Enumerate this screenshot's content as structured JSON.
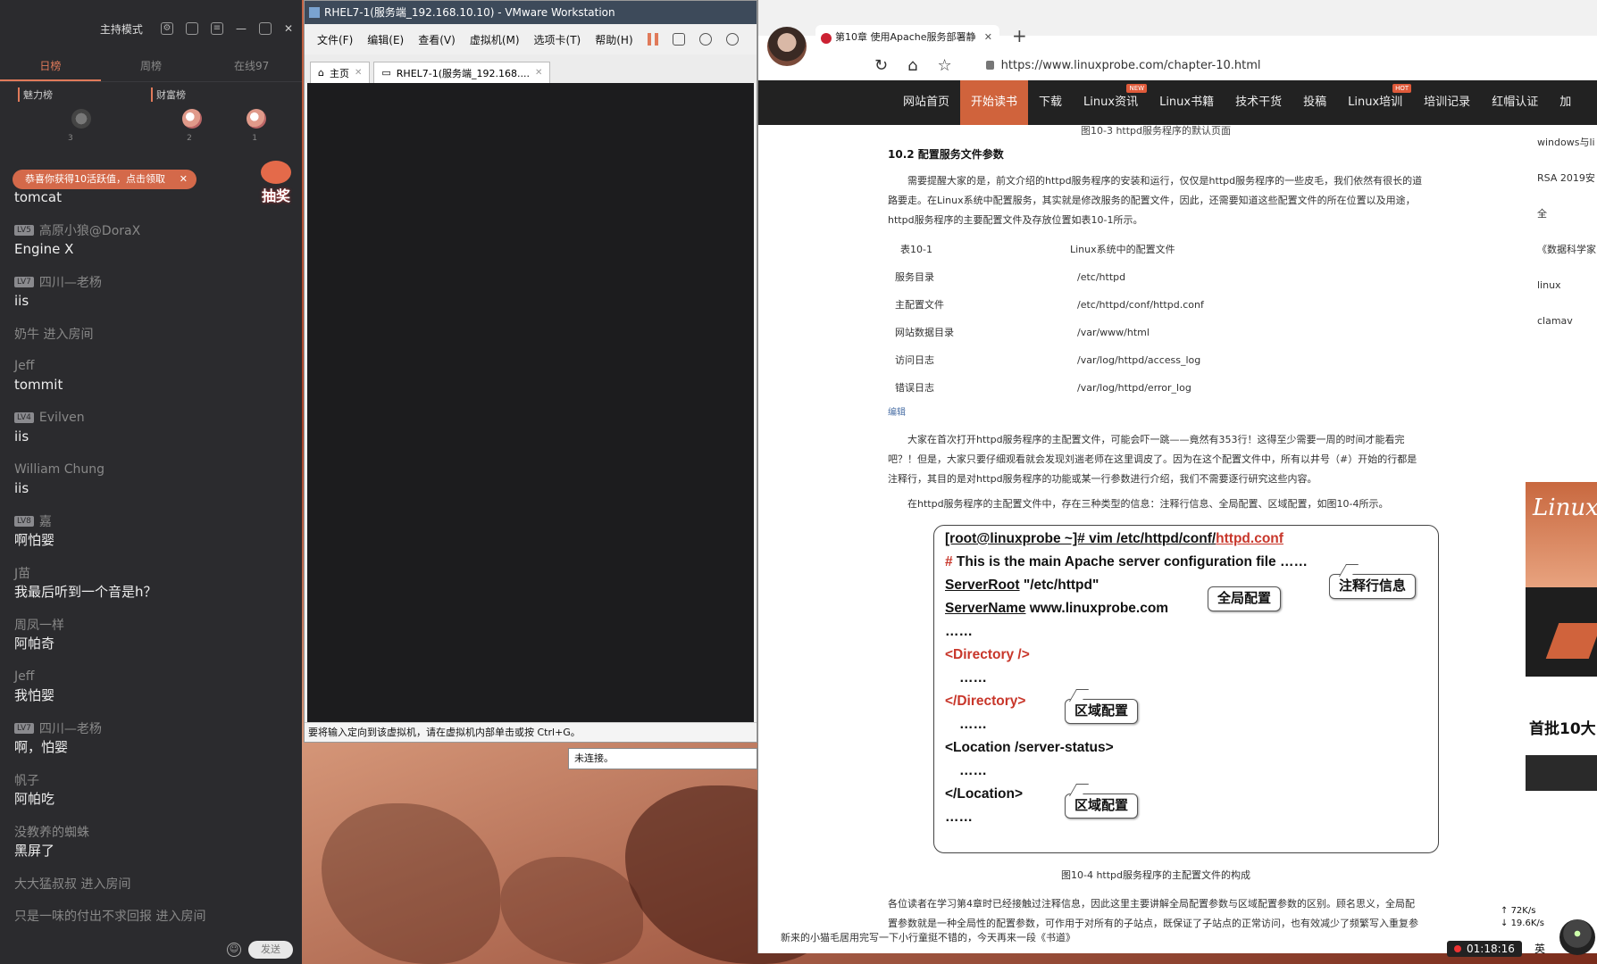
{
  "chat": {
    "mode_label": "主持模式",
    "tabs": [
      "日榜",
      "周榜",
      "在线97"
    ],
    "rank_labels": [
      "魅力榜",
      "财富榜"
    ],
    "rank_numbers": [
      "3",
      "2",
      "1"
    ],
    "gift_banner": "恭喜你获得10活跃值，点击领取",
    "lottery_label": "抽奖",
    "messages": [
      {
        "user": "",
        "lv": "",
        "text": "tomcat"
      },
      {
        "user": "高原小狼@DoraX",
        "lv": "LV5",
        "text": "Engine X"
      },
      {
        "user": "四川—老杨",
        "lv": "LV7",
        "text": "iis"
      },
      {
        "user": "奶牛 进入房间",
        "lv": "",
        "text": ""
      },
      {
        "user": "Jeff",
        "lv": "",
        "text": "tommit"
      },
      {
        "user": "Evilven",
        "lv": "LV4",
        "text": "iis"
      },
      {
        "user": "William Chung",
        "lv": "",
        "text": "iis"
      },
      {
        "user": "嘉",
        "lv": "LV8",
        "text": "啊怕婴"
      },
      {
        "user": "J苗",
        "lv": "",
        "text": "我最后听到一个音是h？"
      },
      {
        "user": "周凤一样",
        "lv": "",
        "text": "阿帕奇"
      },
      {
        "user": "Jeff",
        "lv": "",
        "text": "我怕婴"
      },
      {
        "user": "四川—老杨",
        "lv": "LV7",
        "text": "啊，怕婴"
      },
      {
        "user": "帆子",
        "lv": "",
        "text": "阿帕吃"
      },
      {
        "user": "没教养的蜘蛛",
        "lv": "",
        "text": "黑屏了"
      },
      {
        "user": "大大猛叔叔 进入房间",
        "lv": "",
        "text": ""
      },
      {
        "user": "只是一味的付出不求回报 进入房间",
        "lv": "",
        "text": ""
      }
    ],
    "send_label": "发送"
  },
  "vmware": {
    "title": "RHEL7-1(服务端_192.168.10.10) - VMware Workstation",
    "menu": [
      "文件(F)",
      "编辑(E)",
      "查看(V)",
      "虚拟机(M)",
      "选项卡(T)",
      "帮助(H)"
    ],
    "tabs": [
      "主页",
      "RHEL7-1(服务端_192.168...."
    ],
    "status": "要将输入定向到该虚拟机，请在虚拟机内部单击或按 Ctrl+G。",
    "not_connected": "未连接。"
  },
  "browser": {
    "tab_title": "第10章 使用Apache服务部署静",
    "url": "https://www.linuxprobe.com/chapter-10.html",
    "nav": [
      {
        "label": "网站首页",
        "badge": ""
      },
      {
        "label": "开始读书",
        "badge": "",
        "active": true
      },
      {
        "label": "下载",
        "badge": ""
      },
      {
        "label": "Linux资讯",
        "badge": "NEW"
      },
      {
        "label": "Linux书籍",
        "badge": ""
      },
      {
        "label": "技术干货",
        "badge": ""
      },
      {
        "label": "投稿",
        "badge": ""
      },
      {
        "label": "Linux培训",
        "badge": "HOT"
      },
      {
        "label": "培训记录",
        "badge": ""
      },
      {
        "label": "红帽认证",
        "badge": ""
      },
      {
        "label": "加",
        "badge": ""
      }
    ]
  },
  "article": {
    "fig_caption_top": "图10-3  httpd服务程序的默认页面",
    "section_title": "10.2 配置服务文件参数",
    "para1": "需要提醒大家的是，前文介绍的httpd服务程序的安装和运行，仅仅是httpd服务程序的一些皮毛，我们依然有很长的道路要走。在Linux系统中配置服务，其实就是修改服务的配置文件，因此，还需要知道这些配置文件的所在位置以及用途，httpd服务程序的主要配置文件及存放位置如表10-1所示。",
    "table_caption_left": "表10-1",
    "table_caption_right": "Linux系统中的配置文件",
    "table_rows": [
      [
        "服务目录",
        "/etc/httpd"
      ],
      [
        "主配置文件",
        "/etc/httpd/conf/httpd.conf"
      ],
      [
        "网站数据目录",
        "/var/www/html"
      ],
      [
        "访问日志",
        "/var/log/httpd/access_log"
      ],
      [
        "错误日志",
        "/var/log/httpd/error_log"
      ]
    ],
    "edit_label": "编辑",
    "para2": "大家在首次打开httpd服务程序的主配置文件，可能会吓一跳——竟然有353行！这得至少需要一周的时间才能看完吧？！但是，大家只要仔细观看就会发现刘遄老师在这里调皮了。因为在这个配置文件中，所有以井号（#）开始的行都是注释行，其目的是对httpd服务程序的功能或某一行参数进行介绍，我们不需要逐行研究这些内容。",
    "para3": "在httpd服务程序的主配置文件中，存在三种类型的信息：注释行信息、全局配置、区域配置，如图10-4所示。",
    "fig_caption": "图10-4  httpd服务程序的主配置文件的构成",
    "para4": "各位读者在学习第4章时已经接触过注释信息，因此这里主要讲解全局配置参数与区域配置参数的区别。顾名思义，全局配置参数就是一种全局性的配置参数，可作用于对所有的子站点，既保证了子站点的正常访问，也有效减少了频繁写入重复参数的工作量。区域"
  },
  "code": {
    "prompt": "[root@linuxprobe ~]# vim /etc/httpd/conf/",
    "prompt_file": "httpd.conf",
    "comment_hash": "#",
    "comment": " This is the main Apache server configuration file ……",
    "server_root_key": "ServerRoot",
    "server_root_val": "  \"/etc/httpd\"",
    "server_name_key": "ServerName",
    "server_name_val": "  www.linuxprobe.com",
    "dots1": "……",
    "dir_open": "<Directory  />",
    "dots2": "……",
    "dir_close": "</Directory>",
    "dots3": "……",
    "loc_open": "<Location /server-status>",
    "dots4": "……",
    "loc_close": "</Location>",
    "dots5": "……",
    "callout_comment": "注释行信息",
    "callout_global": "全局配置",
    "callout_zone1": "区域配置",
    "callout_zone2": "区域配置"
  },
  "ticker": "新来的小猫毛居用完写一下小行童挺不错的，今天再来一段《书道》",
  "sidebar_links": [
    "windows与li",
    "RSA 2019安全",
    "《数据科学家",
    "linux clamav"
  ],
  "ads": {
    "ad1_text": "Linux",
    "ad3_text": "首批10大"
  },
  "overlay": {
    "up_speed": "72K/s",
    "down_speed": "19.6K/s",
    "timer": "01:18:16",
    "ime": "英"
  }
}
